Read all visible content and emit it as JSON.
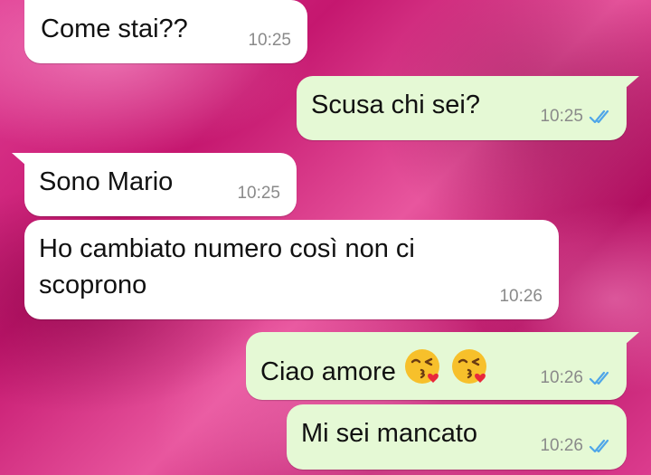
{
  "messages": [
    {
      "direction": "incoming",
      "text": "Come stai??",
      "time": "10:25"
    },
    {
      "direction": "outgoing",
      "text": "Scusa chi sei?",
      "time": "10:25",
      "status": "read"
    },
    {
      "direction": "incoming",
      "text": "Sono Mario",
      "time": "10:25"
    },
    {
      "direction": "incoming",
      "text_line1": "Ho cambiato numero così non ci",
      "text_line2": "scoprono",
      "time": "10:26"
    },
    {
      "direction": "outgoing",
      "text": "Ciao amore",
      "emoji": [
        "face-blowing-kiss",
        "face-blowing-kiss"
      ],
      "time": "10:26",
      "status": "read"
    },
    {
      "direction": "outgoing",
      "text": "Mi sei mancato",
      "time": "10:26",
      "status": "read"
    }
  ],
  "colors": {
    "incoming_bubble": "#ffffff",
    "outgoing_bubble": "#e5f9d5",
    "read_ticks": "#4fa6e8",
    "timestamp": "#8a8a8a",
    "wallpaper": "#d12a80"
  },
  "icons": {
    "read_status": "double-check-icon",
    "emoji": "face-blowing-kiss-emoji"
  }
}
